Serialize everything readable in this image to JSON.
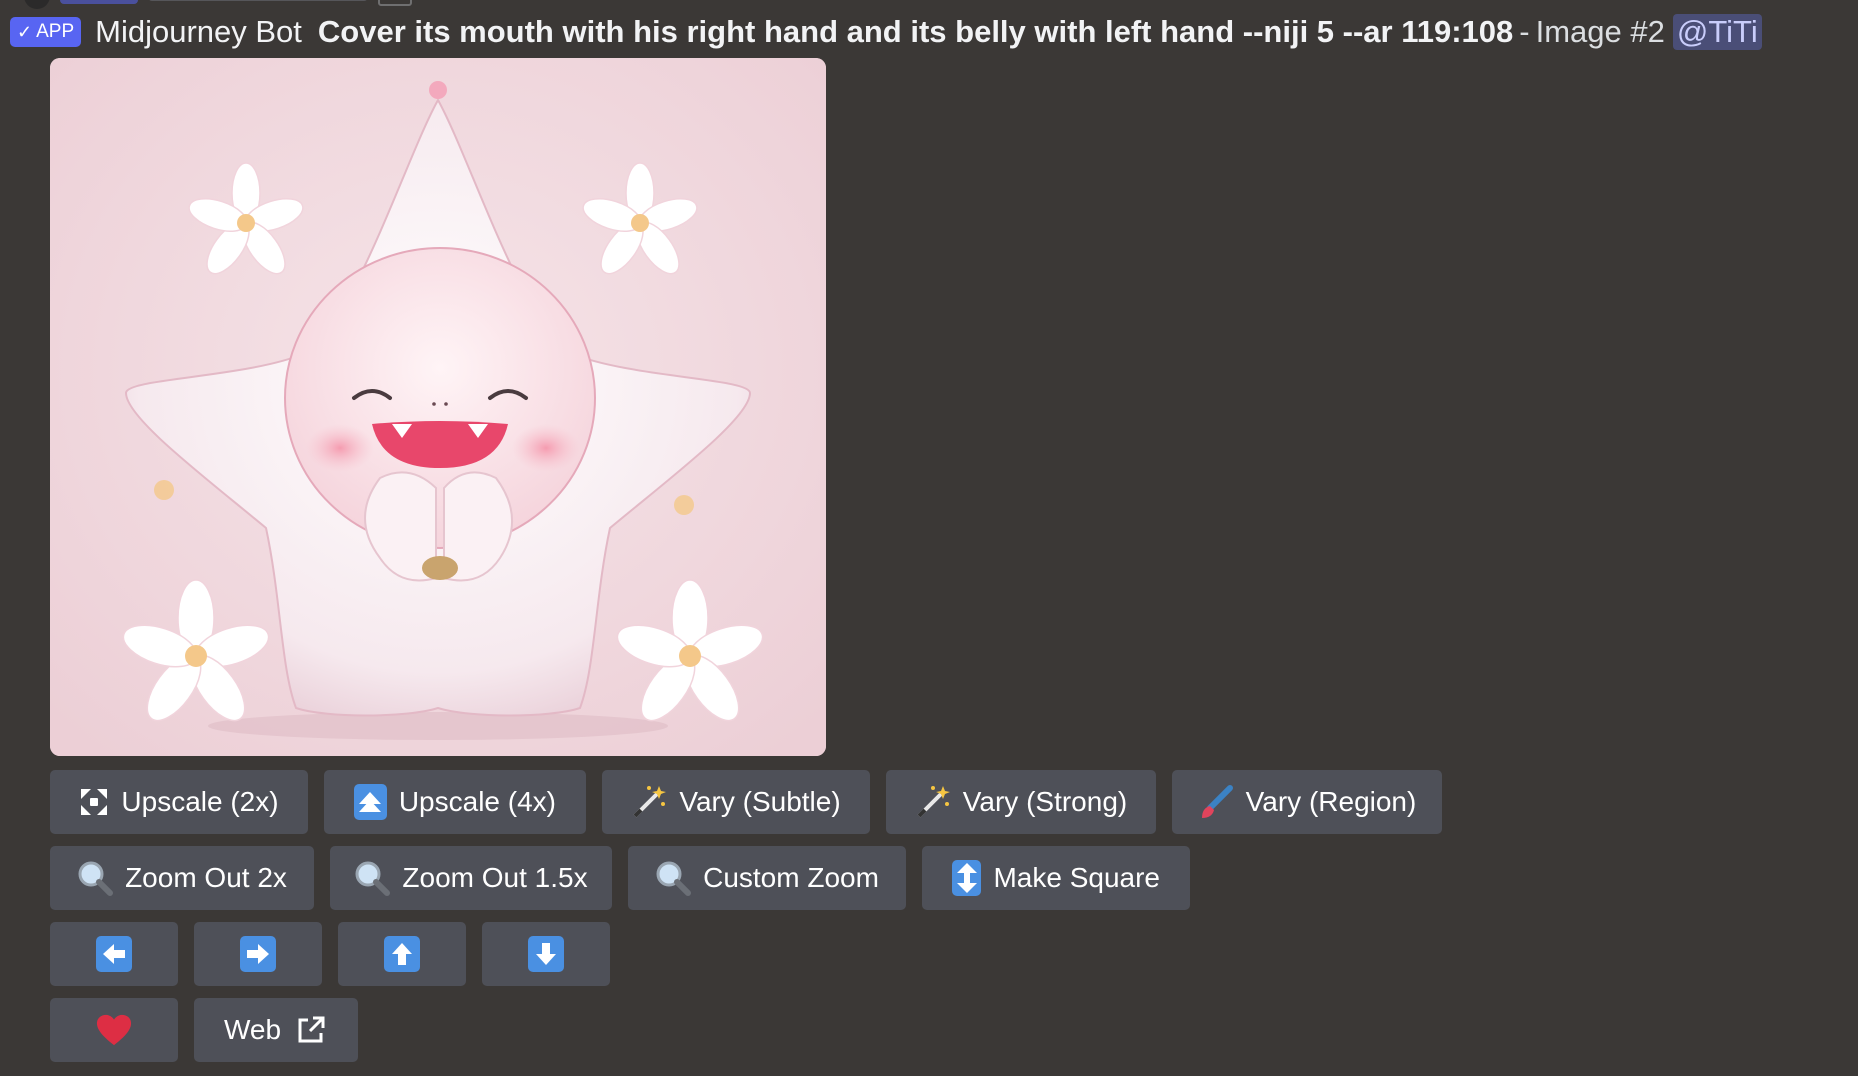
{
  "header": {
    "app_badge": "APP",
    "bot_name": "Midjourney Bot",
    "prompt": "Cover its mouth with his right hand and its belly with left hand --niji 5 --ar 119:108",
    "separator": "-",
    "image_label": "Image #2",
    "mention": "@TiTi"
  },
  "colors": {
    "background": "#3b3836",
    "button": "#4e5058",
    "app_badge": "#5865f2",
    "icon_blue": "#4a90e2",
    "heart": "#dd2e44"
  },
  "buttons": {
    "row1": [
      {
        "label": "Upscale (2x)",
        "icon": "expand-arrows-icon"
      },
      {
        "label": "Upscale (4x)",
        "icon": "up-arrow-box-icon"
      },
      {
        "label": "Vary (Subtle)",
        "icon": "magic-wand-icon"
      },
      {
        "label": "Vary (Strong)",
        "icon": "magic-wand-icon"
      },
      {
        "label": "Vary (Region)",
        "icon": "paintbrush-icon"
      }
    ],
    "row2": [
      {
        "label": "Zoom Out 2x",
        "icon": "magnifier-icon"
      },
      {
        "label": "Zoom Out 1.5x",
        "icon": "magnifier-icon"
      },
      {
        "label": "Custom Zoom",
        "icon": "magnifier-icon"
      },
      {
        "label": "Make Square",
        "icon": "up-down-arrow-icon"
      }
    ],
    "row3": [
      {
        "icon": "left-arrow-icon"
      },
      {
        "icon": "right-arrow-icon"
      },
      {
        "icon": "up-arrow-icon"
      },
      {
        "icon": "down-arrow-icon"
      }
    ],
    "row4": [
      {
        "icon": "heart-icon"
      },
      {
        "label": "Web",
        "icon": "external-link-icon"
      }
    ]
  }
}
